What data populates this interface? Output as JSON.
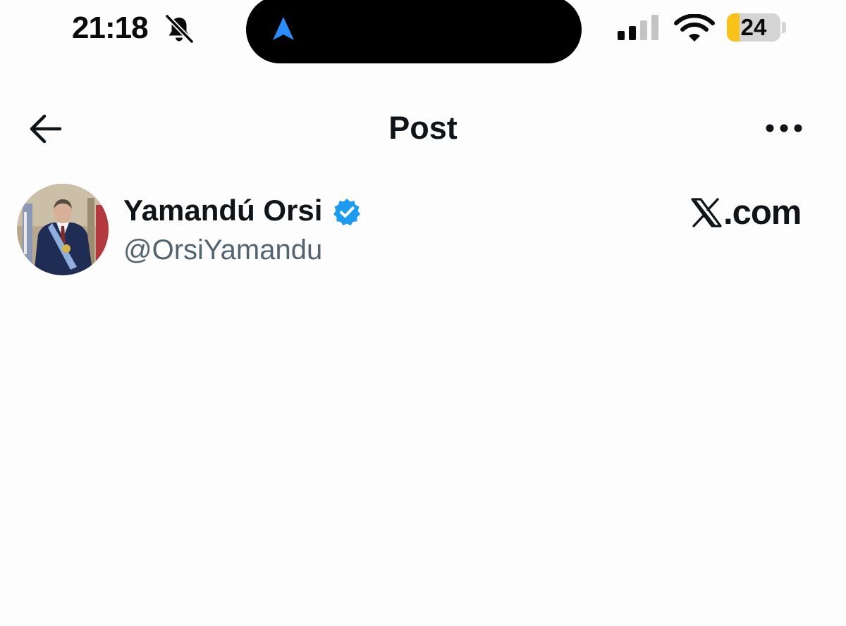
{
  "status_bar": {
    "time": "21:18",
    "battery_level": "24",
    "battery_percent": 24,
    "icons": [
      "bell-slash-icon",
      "navigation-arrow-icon",
      "cellular-signal-icon",
      "wifi-icon",
      "battery-icon"
    ]
  },
  "header": {
    "title": "Post",
    "back_icon": "arrow-left-icon",
    "more_icon": "ellipsis-icon"
  },
  "post": {
    "author_name": "Yamandú Orsi",
    "author_handle": "@OrsiYamandu",
    "verified": true,
    "verified_color": "#1d9bf0"
  },
  "watermark": {
    "text": ".com"
  },
  "colors": {
    "background": "#fdfdfd",
    "text_primary": "#0f1419",
    "text_secondary": "#536471",
    "accent": "#1d9bf0",
    "battery_low": "#f9c21a",
    "island": "#000000"
  }
}
